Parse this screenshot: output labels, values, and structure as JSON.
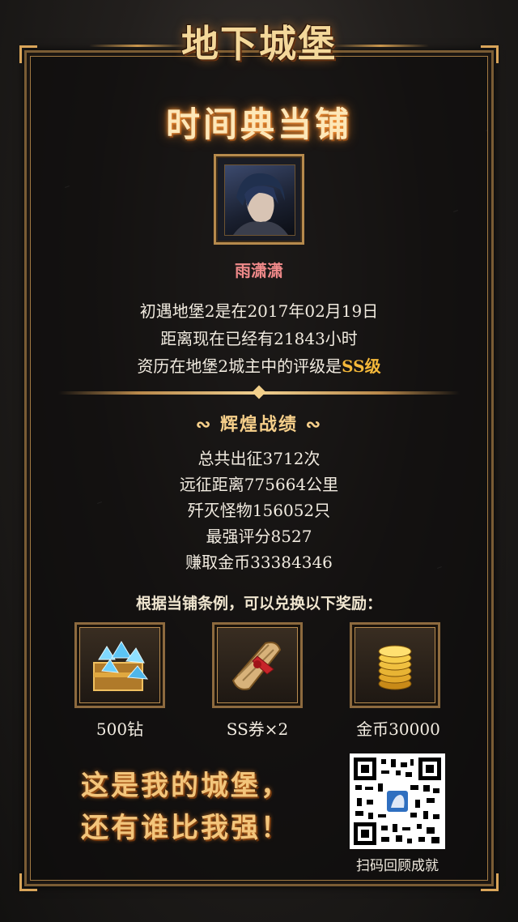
{
  "header": {
    "logo_text": "地下城堡",
    "page_title": "时间典当铺"
  },
  "profile": {
    "username": "雨潇潇",
    "line1": "初遇地堡2是在2017年02月19日",
    "line2": "距离现在已经有21843小时",
    "line3_prefix": "资历在地堡2城主中的评级是",
    "line3_rank": "SS级"
  },
  "achievements": {
    "title": "辉煌战绩",
    "stats": [
      "总共出征3712次",
      "远征距离775664公里",
      "歼灭怪物156052只",
      "最强评分8527",
      "赚取金币33384346"
    ]
  },
  "rewards": {
    "intro": "根据当铺条例，可以兑换以下奖励：",
    "items": [
      {
        "label": "500钻",
        "icon": "diamond-chest-icon"
      },
      {
        "label": "SS券×2",
        "icon": "scroll-icon"
      },
      {
        "label": "金币30000",
        "icon": "gold-coins-icon"
      }
    ]
  },
  "footer": {
    "slogan_line1": "这是我的城堡，",
    "slogan_line2": "还有谁比我强！",
    "qr_caption": "扫码回顾成就"
  },
  "colors": {
    "accent_gold": "#f5b93a",
    "username": "#f08a8a",
    "frame": "#b68a4c"
  }
}
